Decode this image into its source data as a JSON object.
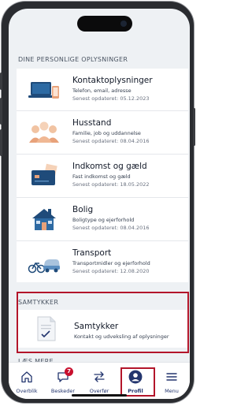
{
  "personal_info": {
    "section_title": "DINE PERSONLIGE OPLYSNINGER",
    "items": [
      {
        "title": "Kontaktoplysninger",
        "subtitle": "Telefon, email, adresse",
        "updated": "Senest opdateret: 05.12.2023",
        "icon": "devices-icon"
      },
      {
        "title": "Husstand",
        "subtitle": "Familie, job og uddannelse",
        "updated": "Senest opdateret: 08.04.2016",
        "icon": "family-icon"
      },
      {
        "title": "Indkomst og gæld",
        "subtitle": "Fast indkomst og gæld",
        "updated": "Senest opdateret: 18.05.2022",
        "icon": "card-icon"
      },
      {
        "title": "Bolig",
        "subtitle": "Boligtype og ejerforhold",
        "updated": "Senest opdateret: 08.04.2016",
        "icon": "house-icon"
      },
      {
        "title": "Transport",
        "subtitle": "Transportmidler og ejerforhold",
        "updated": "Senest opdateret: 12.08.2020",
        "icon": "transport-icon"
      }
    ]
  },
  "consents": {
    "section_title": "SAMTYKKER",
    "item": {
      "title": "Samtykker",
      "subtitle": "Kontakt og udveksling af oplysninger",
      "icon": "document-check-icon"
    }
  },
  "next_section_partial": "LÆS MERE",
  "bottom_nav": {
    "items": [
      {
        "label": "Overblik",
        "icon": "home-icon"
      },
      {
        "label": "Beskeder",
        "icon": "messages-icon",
        "badge": "7"
      },
      {
        "label": "Overfør",
        "icon": "transfer-icon"
      },
      {
        "label": "Profil",
        "icon": "profile-icon",
        "active": true
      },
      {
        "label": "Menu",
        "icon": "menu-icon"
      }
    ]
  },
  "colors": {
    "navy": "#23356e",
    "accent_red": "#b3152a",
    "badge_red": "#c8102e",
    "screen_bg": "#eef1f4"
  }
}
